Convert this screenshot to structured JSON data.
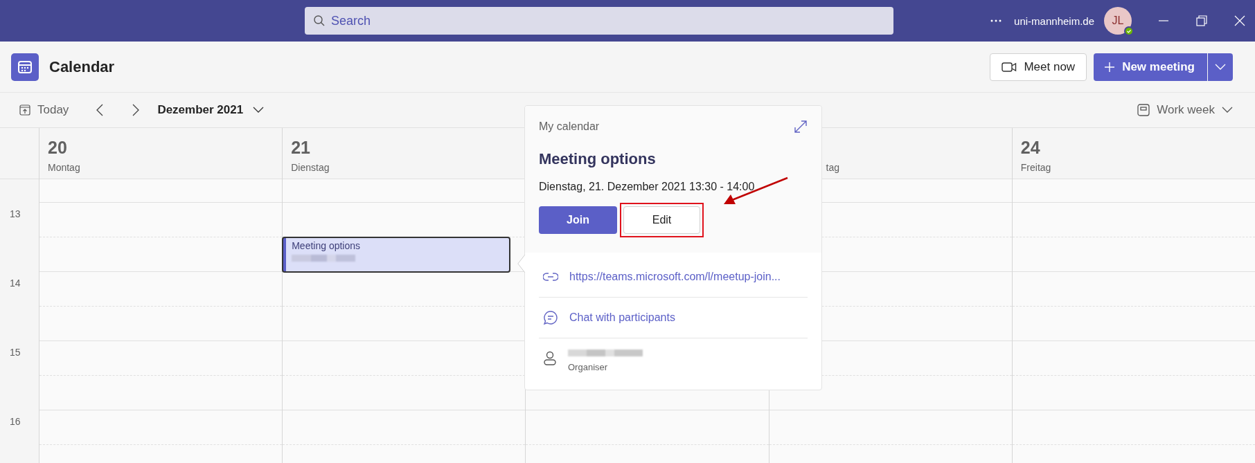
{
  "title_bar": {
    "search": {
      "placeholder": "Search"
    },
    "account": "uni-mannheim.de",
    "avatar": {
      "initials": "JL"
    }
  },
  "app": {
    "title": "Calendar",
    "buttons": [
      {
        "label": "Meet now",
        "kind": "secondary"
      },
      {
        "label": "New meeting",
        "kind": "primary"
      }
    ]
  },
  "toolbar": {
    "today": "Today",
    "period": "Dezember 2021",
    "view": "Work week"
  },
  "days": [
    {
      "kind": "day",
      "number": "20",
      "name": "Montag"
    },
    {
      "kind": "day",
      "number": "21",
      "name": "Dienstag",
      "events": [
        {
          "title": "Meeting options",
          "selected": true
        }
      ]
    },
    {
      "kind": "covered"
    },
    {
      "kind": "day",
      "name": "tag",
      "cut": true
    },
    {
      "kind": "day",
      "number": "24",
      "name": "Freitag"
    }
  ],
  "hours": [
    "13",
    "14",
    "15",
    "16"
  ],
  "popup": {
    "calendar": "My calendar",
    "title": "Meeting options",
    "when": "Dienstag, 21. Dezember 2021 13:30 - 14:00",
    "actions": [
      {
        "label": "Join",
        "kind": "primary",
        "highlighted": false
      },
      {
        "label": "Edit",
        "kind": "secondary",
        "highlighted": true
      }
    ],
    "details": [
      {
        "kind": "link",
        "text": "https://teams.microsoft.com/l/meetup-join..."
      },
      {
        "kind": "chat",
        "text": "Chat with participants"
      },
      {
        "kind": "person",
        "caption": "Organiser"
      }
    ]
  }
}
